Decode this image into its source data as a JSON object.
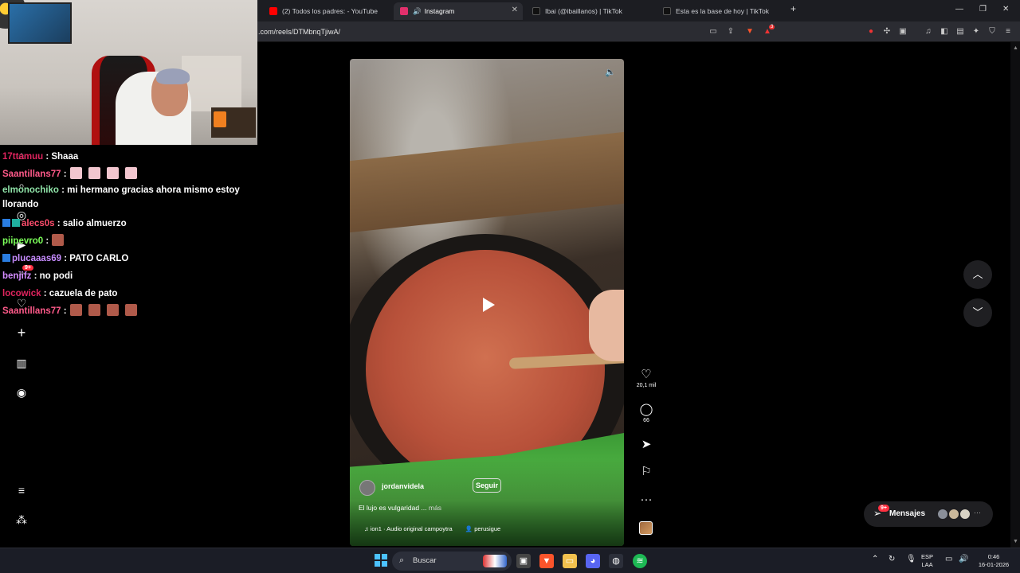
{
  "browser": {
    "tabs": [
      {
        "title": "(2) Todos los padres: - YouTube",
        "favicon_color": "#ff0000",
        "active": false
      },
      {
        "title": "Instagram",
        "favicon_color": "#e1306c",
        "active": true
      },
      {
        "title": "Ibai (@ibaillanos) | TikTok",
        "favicon_color": "#111111",
        "active": false
      },
      {
        "title": "Esta es la base de hoy | TikTok",
        "favicon_color": "#111111",
        "active": false
      }
    ],
    "new_tab_label": "+",
    "url": ".com/reels/DTMbnqTjiwA/",
    "notification_count": "3"
  },
  "chat": [
    {
      "user": "17ttamuu",
      "color": "#e0245e",
      "msg": ": Shaaa"
    },
    {
      "user": "Saantillans77",
      "color": "#ff5a8a",
      "msg": ":",
      "emotes": 4,
      "emote_color": "#f2c6cf"
    },
    {
      "user": "elmonochiko",
      "color": "#8fe3a8",
      "msg": ": mi hermano gracias ahora mismo estoy llorando"
    },
    {
      "user": "alecs0s",
      "color": "#ff4d6d",
      "msg": ": salio almuerzo",
      "badges": 2
    },
    {
      "user": "piipevro0",
      "color": "#7cff5a",
      "msg": ":",
      "emotes": 1,
      "emote_color": "#b05a4a"
    },
    {
      "user": "plucaaas69",
      "color": "#c78cff",
      "msg": ": PATO CARLO",
      "badges": 1
    },
    {
      "user": "benjifz",
      "color": "#d48cff",
      "msg": ": no podi"
    },
    {
      "user": "locowick",
      "color": "#e0245e",
      "msg": ": cazuela de pato"
    },
    {
      "user": "Saantillans77",
      "color": "#ff5a8a",
      "msg": ":",
      "emotes": 4,
      "emote_color": "#b05a4a"
    }
  ],
  "sidebar": {
    "icons": [
      "home-icon",
      "search-icon",
      "explore-icon",
      "reels-icon",
      "messages-icon",
      "notifications-icon",
      "create-icon",
      "dashboard-icon",
      "profile-icon",
      "menu-icon",
      "more-apps-icon"
    ],
    "messages_badge": "9+"
  },
  "reel": {
    "author": "jordanvidela",
    "follow_label": "Seguir",
    "caption": "El lujo es vulgaridad ...",
    "caption_more": "más",
    "audio_text": "ion1 · Audio original  campoytra",
    "tagged_user": "perusigue",
    "likes": "20,1 mil",
    "comments": "66"
  },
  "messages_bar": {
    "label": "Mensajes",
    "badge": "9+",
    "more": "···"
  },
  "taskbar": {
    "search_placeholder": "Buscar",
    "lang_top": "ESP",
    "lang_bottom": "LAA",
    "time": "0:46",
    "date": "16-01-2026"
  },
  "colors": {
    "page_bg": "#000000",
    "like_badge": "#ff3040",
    "taskbar_bg": "#1b1d26"
  }
}
